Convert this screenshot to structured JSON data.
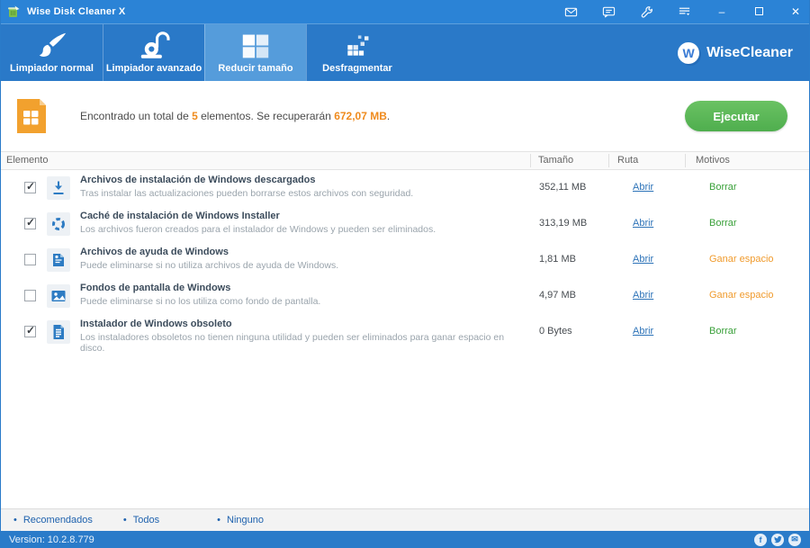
{
  "window": {
    "title": "Wise Disk Cleaner X",
    "titlebar_icon_names": [
      "app-icon",
      "mail-icon",
      "feedback-icon",
      "tools-icon",
      "menu-icon"
    ],
    "controls": [
      "minimize",
      "maximize",
      "close"
    ]
  },
  "tabs": [
    {
      "label": "Limpiador normal",
      "icon": "brush-icon",
      "active": false
    },
    {
      "label": "Limpiador avanzado",
      "icon": "vacuum-icon",
      "active": false
    },
    {
      "label": "Reducir tamaño",
      "icon": "windows-icon",
      "active": true
    },
    {
      "label": "Desfragmentar",
      "icon": "defrag-icon",
      "active": false
    }
  ],
  "brand": {
    "letter": "W",
    "name": "WiseCleaner"
  },
  "summary": {
    "prefix": "Encontrado un total de ",
    "count": "5",
    "middle": " elementos. Se recuperarán ",
    "size": "672,07 MB",
    "suffix": ".",
    "icon": "windows-document-icon",
    "button": "Ejecutar"
  },
  "table": {
    "headers": [
      "Elemento",
      "Tamaño",
      "Ruta",
      "Motivos"
    ],
    "rows": [
      {
        "checkbox_class": "rowcheck checked",
        "icon": "download-icon",
        "title": "Archivos de instalación de Windows descargados",
        "description": "Tras instalar las actualizaciones pueden borrarse estos archivos con seguridad.",
        "size": "352,11 MB",
        "ruta": "Abrir",
        "motivo": "Borrar",
        "motivo_class": "rowmotivo green"
      },
      {
        "checkbox_class": "rowcheck checked",
        "icon": "sync-icon",
        "title": "Caché de instalación de Windows Installer",
        "description": "Los archivos fueron creados para el instalador de Windows y pueden ser eliminados.",
        "size": "313,19 MB",
        "ruta": "Abrir",
        "motivo": "Borrar",
        "motivo_class": "rowmotivo green"
      },
      {
        "checkbox_class": "rowcheck",
        "icon": "help-files-icon",
        "title": "Archivos de ayuda de Windows",
        "description": "Puede eliminarse si no utiliza archivos de ayuda de Windows.",
        "size": "1,81 MB",
        "ruta": "Abrir",
        "motivo": "Ganar espacio",
        "motivo_class": "rowmotivo orange"
      },
      {
        "checkbox_class": "rowcheck",
        "icon": "wallpaper-icon",
        "title": "Fondos de pantalla de Windows",
        "description": "Puede eliminarse si no los utiliza como fondo de pantalla.",
        "size": "4,97 MB",
        "ruta": "Abrir",
        "motivo": "Ganar espacio",
        "motivo_class": "rowmotivo orange"
      },
      {
        "checkbox_class": "rowcheck checked",
        "icon": "installer-doc-icon",
        "title": "Instalador de Windows obsoleto",
        "description": "Los instaladores obsoletos no tienen ninguna utilidad y pueden ser eliminados para ganar espacio en disco.",
        "size": "0 Bytes",
        "ruta": "Abrir",
        "motivo": "Borrar",
        "motivo_class": "rowmotivo green"
      }
    ]
  },
  "footer": {
    "links": [
      "Recomendados",
      "Todos",
      "Ninguno"
    ]
  },
  "statusbar": {
    "version": "Version: 10.2.8.779",
    "social_icons": [
      "facebook-icon",
      "twitter-icon",
      "email-icon"
    ]
  },
  "colors": {
    "titlebar": "#2b83d6",
    "tabbar": "#2a79c8",
    "tab_active": "#559cdb",
    "statusbar": "#2a7bc9",
    "accent_orange": "#ef8b1e",
    "button_green": "#4fae4e",
    "motivo_green": "#39a039",
    "motivo_orange": "#f09b2d",
    "link_blue": "#2d73b8"
  }
}
